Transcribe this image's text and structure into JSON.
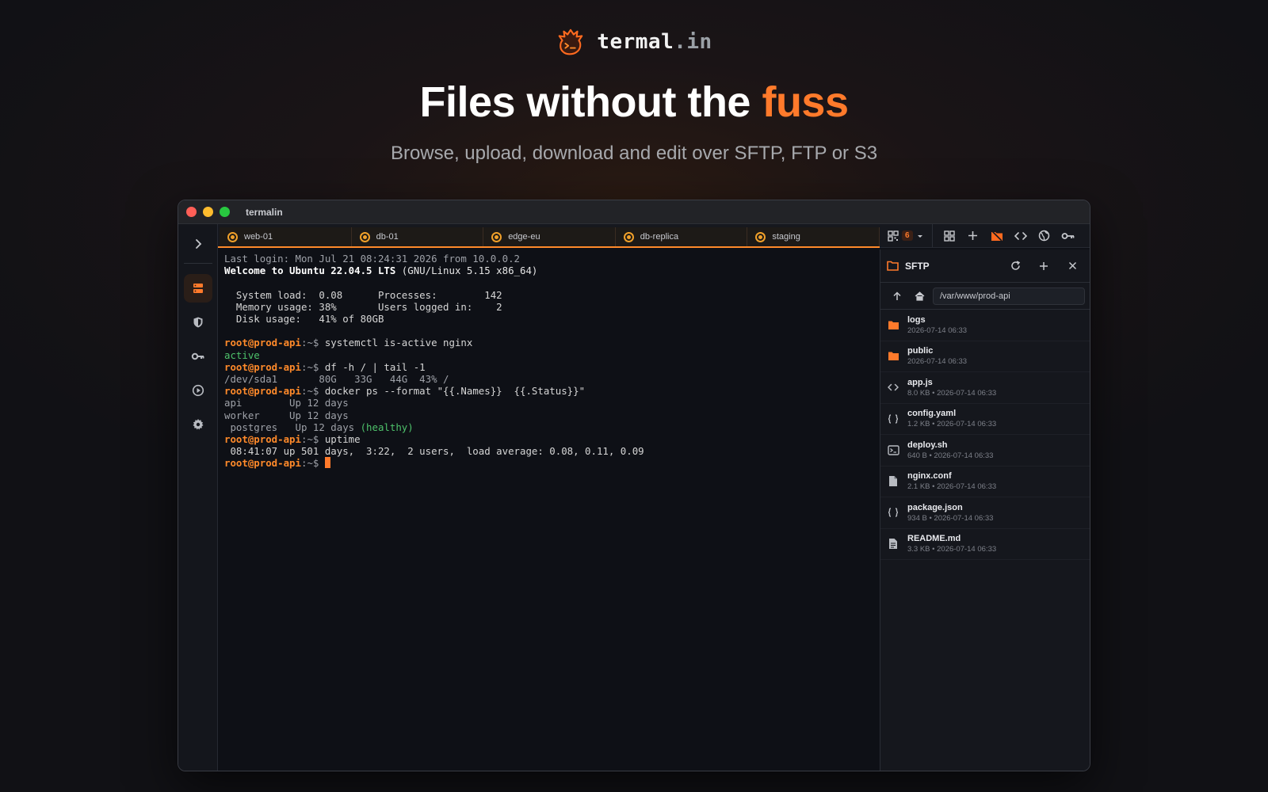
{
  "brand": {
    "name": "termal",
    "suffix": ".in"
  },
  "hero": {
    "headline_prefix": "Files without the ",
    "headline_accent": "fuss",
    "subline": "Browse, upload, download and edit over SFTP, FTP or S3"
  },
  "colors": {
    "accent": "#ff7a2b",
    "background": "#111115",
    "prompt": "#ff8a2a",
    "green": "#4ec26b"
  },
  "window": {
    "title": "termalin"
  },
  "sidebar": {
    "items": [
      {
        "icon": "chevron-right-icon"
      },
      {
        "icon": "server-icon",
        "active": true
      },
      {
        "icon": "shield-icon"
      },
      {
        "icon": "key-icon"
      },
      {
        "icon": "play-icon"
      },
      {
        "icon": "gear-icon"
      }
    ]
  },
  "tabs": [
    {
      "label": "web-01"
    },
    {
      "label": "db-01"
    },
    {
      "label": "edge-eu"
    },
    {
      "label": "db-replica"
    },
    {
      "label": "staging"
    }
  ],
  "toolbar": {
    "session_count": "6"
  },
  "terminal": {
    "last_login": "Last login: Mon Jul 21 08:24:31 2026 from 10.0.0.2",
    "welcome_bold": "Welcome to Ubuntu 22.04.5 LTS",
    "welcome_rest": " (GNU/Linux 5.15 x86_64)",
    "sysinfo_1": "  System load:  0.08      Processes:        142",
    "sysinfo_2": "  Memory usage: 38%       Users logged in:    2",
    "sysinfo_3": "  Disk usage:   41% of 80GB",
    "prompt_user": "root@prod-api",
    "prompt_path": ":~$ ",
    "cmd_1": "systemctl is-active nginx",
    "out_1": "active",
    "cmd_2": "df -h / | tail -1",
    "out_2": "/dev/sda1       80G   33G   44G  43% /",
    "cmd_3": "docker ps --format \"{{.Names}}  {{.Status}}\"",
    "out_3a": "api        Up 12 days",
    "out_3b": "worker     Up 12 days",
    "out_3c_plain": " postgres   Up 12 days ",
    "out_3c_green": "(healthy)",
    "cmd_4": "uptime",
    "out_4": " 08:41:07 up 501 days,  3:22,  2 users,  load average: 0.08, 0.11, 0.09"
  },
  "sftp": {
    "title": "SFTP",
    "path": "/var/www/prod-api",
    "files": [
      {
        "name": "logs",
        "meta": "2026-07-14 06:33",
        "icon": "folder-icon"
      },
      {
        "name": "public",
        "meta": "2026-07-14 06:33",
        "icon": "folder-icon"
      },
      {
        "name": "app.js",
        "meta": "8.0 KB • 2026-07-14 06:33",
        "icon": "code-icon"
      },
      {
        "name": "config.yaml",
        "meta": "1.2 KB • 2026-07-14 06:33",
        "icon": "braces-icon"
      },
      {
        "name": "deploy.sh",
        "meta": "640 B • 2026-07-14 06:33",
        "icon": "terminal-file-icon"
      },
      {
        "name": "nginx.conf",
        "meta": "2.1 KB • 2026-07-14 06:33",
        "icon": "file-icon"
      },
      {
        "name": "package.json",
        "meta": "934 B • 2026-07-14 06:33",
        "icon": "braces-icon"
      },
      {
        "name": "README.md",
        "meta": "3.3 KB • 2026-07-14 06:33",
        "icon": "document-icon"
      }
    ]
  }
}
